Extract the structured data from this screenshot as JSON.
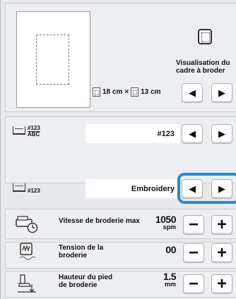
{
  "preview": {
    "vis_label": "Visualisation du cadre à broder",
    "dim_width": "18 cm",
    "dim_times": "×",
    "dim_height": "13 cm"
  },
  "thread_number": {
    "tag_line1": "#123",
    "tag_line2": "ABC",
    "value": "#123"
  },
  "thread_brand": {
    "tag": "#123",
    "value": "Embroidery"
  },
  "settings": [
    {
      "label": "Vitesse de broderie max",
      "value": "1050",
      "unit": "spm"
    },
    {
      "label": "Tension de la broderie",
      "value": "00",
      "unit": ""
    },
    {
      "label": "Hauteur du pied de broderie",
      "value": "1.5",
      "unit": "mm"
    }
  ],
  "glyphs": {
    "left": "◀",
    "right": "▶",
    "minus": "−",
    "plus": "+"
  },
  "colors": {
    "highlight": "#2d88cf"
  }
}
